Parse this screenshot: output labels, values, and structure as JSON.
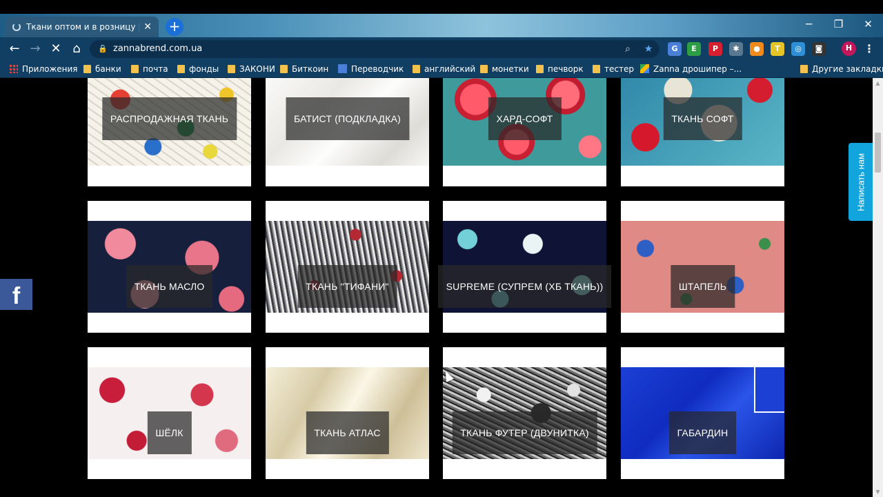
{
  "browser": {
    "tab": {
      "title": "Ткани оптом и в розницу | Инте",
      "close_glyph": "✕"
    },
    "new_tab_glyph": "+",
    "window_controls": {
      "minimize": "─",
      "restore": "❐",
      "close": "✕"
    },
    "nav": {
      "back": "←",
      "forward": "→",
      "reload": "✕",
      "home": "⌂"
    },
    "address": {
      "url": "zannabrend.com.ua",
      "lock_glyph": "🔒"
    },
    "omnibox_icons": {
      "zoom": "⌕",
      "star": "★"
    },
    "extensions": [
      {
        "name": "translate-extension-icon",
        "glyph": "G",
        "color": "#4a7fd9"
      },
      {
        "name": "evernote-extension-icon",
        "glyph": "E",
        "color": "#2e9e45"
      },
      {
        "name": "pinterest-extension-icon",
        "glyph": "P",
        "color": "#d6202f"
      },
      {
        "name": "puzzle-extension-icon",
        "glyph": "✱",
        "color": "#5a7890"
      },
      {
        "name": "orange-extension-icon",
        "glyph": "●",
        "color": "#f08a1c"
      },
      {
        "name": "t-extension-icon",
        "glyph": "T",
        "color": "#e6c327"
      },
      {
        "name": "blue-extension-icon",
        "glyph": "◎",
        "color": "#2d8fd6"
      },
      {
        "name": "camera-extension-icon",
        "glyph": "◙",
        "color": "#333333"
      }
    ],
    "profile_initial": "H",
    "menu_glyph": "⋮",
    "bookmarks": {
      "apps": "Приложения",
      "items": [
        "банки",
        "почта",
        "фонды",
        "ЗАКОНИ",
        "Биткоин",
        "Переводчик",
        "английский",
        "монетки",
        "печворк",
        "тестер",
        "Zanna дрошипер –..."
      ],
      "other": "Другие закладки"
    }
  },
  "page": {
    "categories": [
      {
        "label": "РАСПРОДАЖНАЯ ТКАНЬ",
        "texture": "p-parrot"
      },
      {
        "label": "БАТИСТ (ПОДКЛАДКА)",
        "texture": "p-white"
      },
      {
        "label": "ХАРД-СОФТ",
        "texture": "p-roses-red"
      },
      {
        "label": "ТКАНЬ СОФТ",
        "texture": "p-soft"
      },
      {
        "label": "ТКАНЬ МАСЛО",
        "texture": "p-maslo"
      },
      {
        "label": "ТКАНЬ \"ТИФАНИ\"",
        "texture": "p-tifani"
      },
      {
        "label": "SUPREME (СУПРЕМ (ХБ ТКАНЬ))",
        "texture": "p-supreme"
      },
      {
        "label": "ШТАПЕЛЬ",
        "texture": "p-shtapel"
      },
      {
        "label": "ШЁЛК",
        "texture": "p-silk"
      },
      {
        "label": "ТКАНЬ АТЛАС",
        "texture": "p-atlas"
      },
      {
        "label": "ТКАНЬ ФУТЕР (ДВУНИТКА)",
        "texture": "p-futer"
      },
      {
        "label": "ГАБАРДИН",
        "texture": "p-gabardin"
      }
    ],
    "facebook_glyph": "f",
    "write_us": "Написать нам"
  },
  "colors": {
    "facebook": "#3b5998",
    "write_us": "#12a4dc",
    "toolbar": "#113f64"
  }
}
